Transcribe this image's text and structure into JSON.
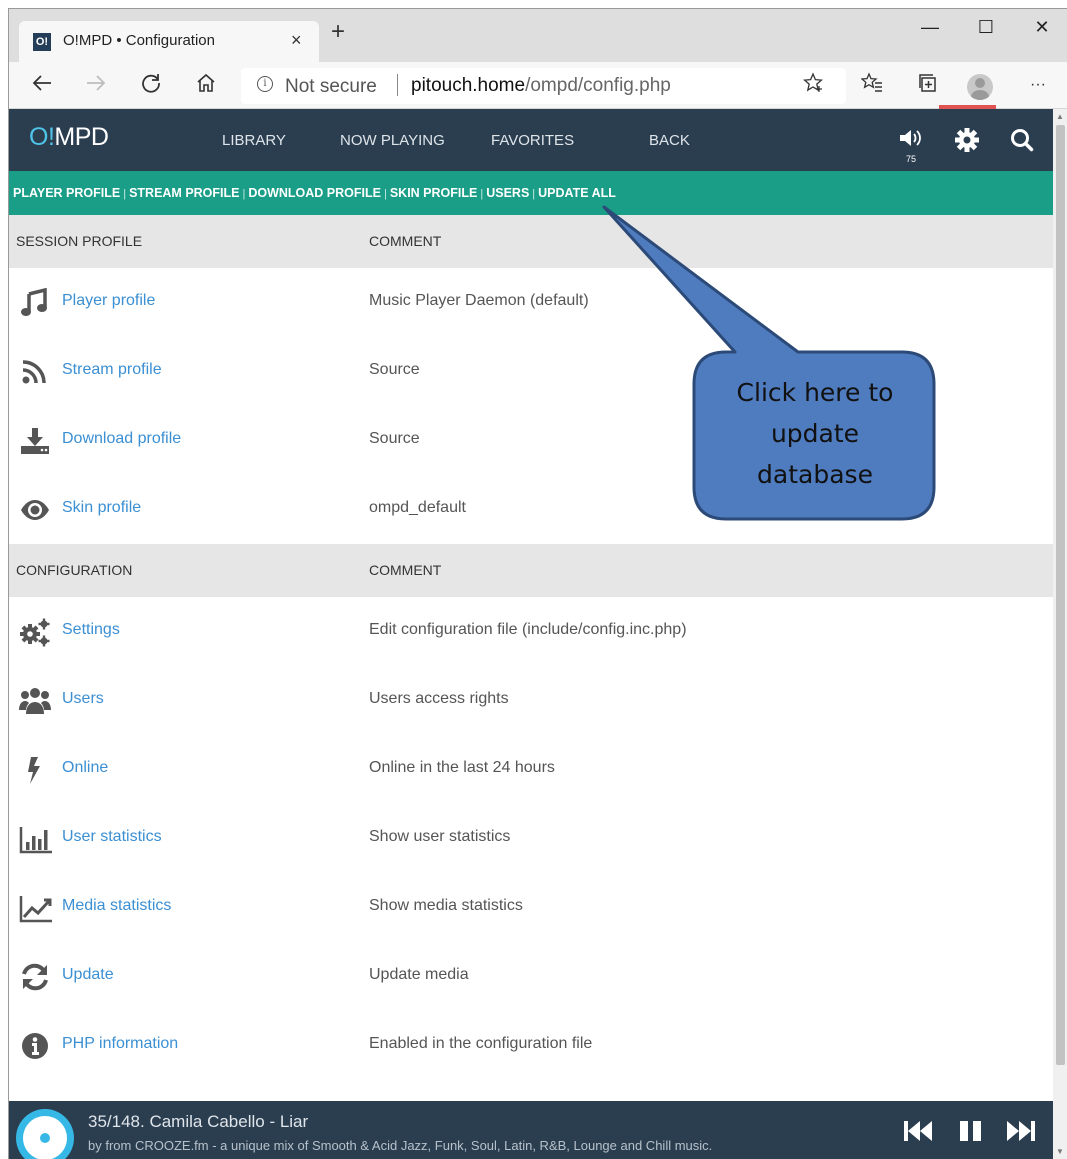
{
  "browser": {
    "tab": {
      "favicon": "O!",
      "title": "O!MPD • Configuration",
      "close": "×"
    },
    "new_tab": "+",
    "window_controls": {
      "minimize": "—",
      "maximize": "☐",
      "close": "✕"
    },
    "address_bar": {
      "info": "i",
      "security_label": "Not secure",
      "url_host": "pitouch.home",
      "url_path": "/ompd/config.php"
    },
    "more": "···"
  },
  "app": {
    "logo_prefix": "O!",
    "logo_suffix": "MPD",
    "menu": [
      "LIBRARY",
      "NOW PLAYING",
      "FAVORITES",
      "BACK"
    ],
    "volume": "75",
    "submenu": [
      "PLAYER PROFILE",
      "STREAM PROFILE",
      "DOWNLOAD PROFILE",
      "SKIN PROFILE",
      "USERS",
      "UPDATE ALL"
    ],
    "submenu_separator": "|",
    "session_section": {
      "col1": "SESSION PROFILE",
      "col2": "COMMENT",
      "rows": [
        {
          "icon": "music-note-icon",
          "label": "Player profile",
          "comment": "Music Player Daemon (default)"
        },
        {
          "icon": "rss-feed-icon",
          "label": "Stream profile",
          "comment": "Source"
        },
        {
          "icon": "download-icon",
          "label": "Download profile",
          "comment": "Source"
        },
        {
          "icon": "eye-icon",
          "label": "Skin profile",
          "comment": "ompd_default"
        }
      ]
    },
    "config_section": {
      "col1": "CONFIGURATION",
      "col2": "COMMENT",
      "rows": [
        {
          "icon": "gears-icon",
          "label": "Settings",
          "comment": "Edit configuration file (include/config.inc.php)"
        },
        {
          "icon": "users-icon",
          "label": "Users",
          "comment": "Users access rights"
        },
        {
          "icon": "lightning-icon",
          "label": "Online",
          "comment": "Online in the last 24 hours"
        },
        {
          "icon": "bar-chart-icon",
          "label": "User statistics",
          "comment": "Show user statistics"
        },
        {
          "icon": "line-chart-icon",
          "label": "Media statistics",
          "comment": "Show media statistics"
        },
        {
          "icon": "refresh-icon",
          "label": "Update",
          "comment": "Update media"
        },
        {
          "icon": "info-circle-icon",
          "label": "PHP information",
          "comment": "Enabled in the configuration file"
        }
      ]
    },
    "player": {
      "track": "35/148. Camila Cabello - Liar",
      "artist": "by  from CROOZE.fm - a unique mix of Smooth & Acid Jazz, Funk, Soul, Latin, R&B, Lounge and Chill music."
    }
  },
  "callout": {
    "lines": [
      "Click here to",
      "update",
      "database"
    ],
    "fill": "#4f7bbf",
    "stroke": "#2c4a78"
  }
}
